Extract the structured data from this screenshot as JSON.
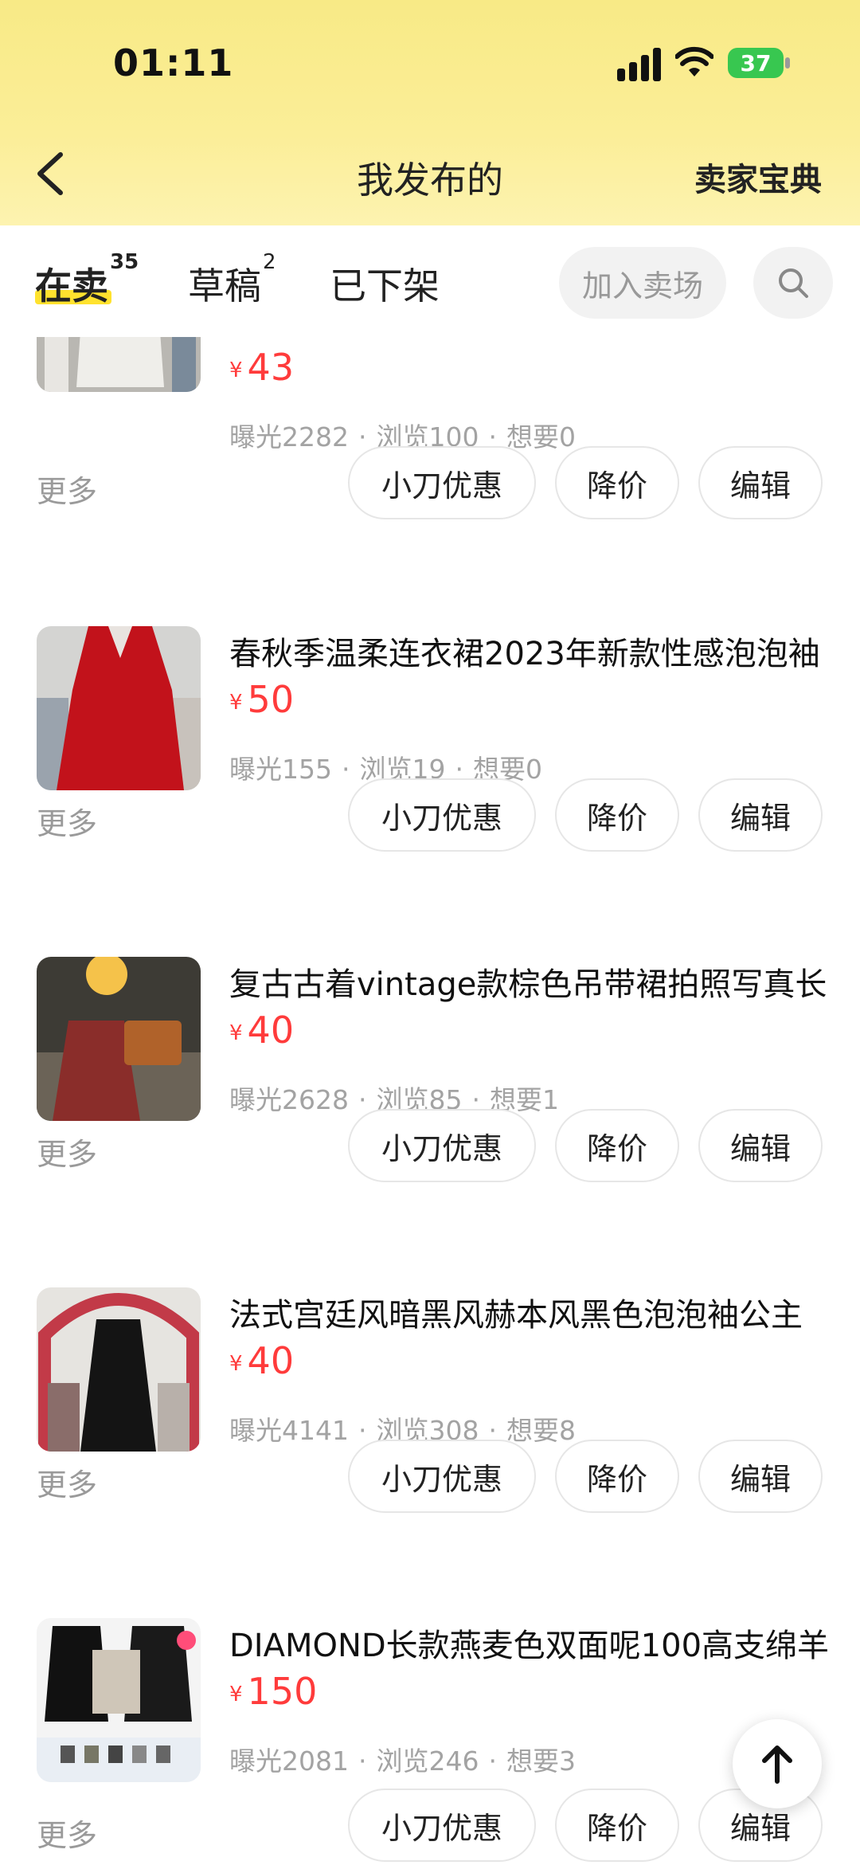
{
  "status_bar": {
    "time": "01:11",
    "battery": "37"
  },
  "header": {
    "title": "我发布的",
    "seller_guide": "卖家宝典"
  },
  "tabs": [
    {
      "label": "在卖",
      "count": "35"
    },
    {
      "label": "草稿",
      "count": "2"
    },
    {
      "label": "已下架",
      "count": ""
    }
  ],
  "join_market": "加入卖场",
  "currency": "¥",
  "actions": {
    "more": "更多",
    "knife_discount": "小刀优惠",
    "reduce_price": "降价",
    "edit": "编辑"
  },
  "items": [
    {
      "title": "",
      "price": "43",
      "exposure": "曝光2282",
      "views": "浏览100",
      "wants": "想要0"
    },
    {
      "title": "春秋季温柔连衣裙2023年新款性感泡泡袖",
      "price": "50",
      "exposure": "曝光155",
      "views": "浏览19",
      "wants": "想要0"
    },
    {
      "title": "复古古着vintage款棕色吊带裙拍照写真长",
      "price": "40",
      "exposure": "曝光2628",
      "views": "浏览85",
      "wants": "想要1"
    },
    {
      "title": "法式宫廷风暗黑风赫本风黑色泡泡袖公主",
      "price": "40",
      "exposure": "曝光4141",
      "views": "浏览308",
      "wants": "想要8"
    },
    {
      "title": "DIAMOND长款燕麦色双面呢100高支绵羊",
      "price": "150",
      "exposure": "曝光2081",
      "views": "浏览246",
      "wants": "想要3"
    }
  ],
  "colors": {
    "header_bg": "#f8ea86",
    "price": "#ff3b3b",
    "tab_underline": "#ffe22e"
  },
  "icons": [
    "back-icon",
    "search-icon",
    "arrow-up-icon",
    "wifi-icon",
    "signal-icon"
  ]
}
